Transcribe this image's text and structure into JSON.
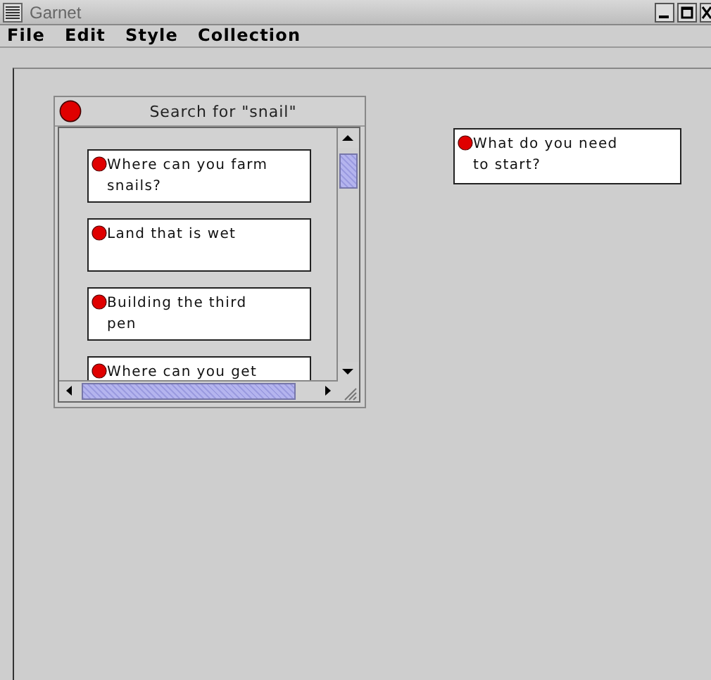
{
  "window": {
    "title": "Garnet"
  },
  "menu": [
    "File",
    "Edit",
    "Style",
    "Collection"
  ],
  "search_panel": {
    "title": "Search for \"snail\"",
    "notes": [
      {
        "text": "Where can you farm snails?"
      },
      {
        "text": "Land that is wet"
      },
      {
        "text": "Building the third pen"
      },
      {
        "text": "Where can you get"
      }
    ]
  },
  "canvas_notes": [
    {
      "text": "What do you need to start?"
    }
  ]
}
